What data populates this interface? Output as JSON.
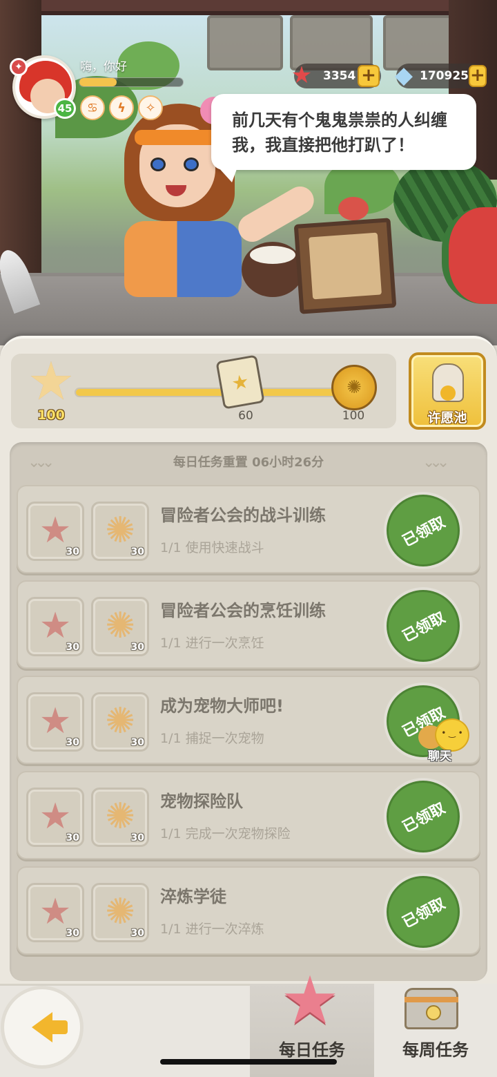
{
  "header": {
    "greeting": "嗨，你好",
    "level": "45",
    "xp_fraction": 0.36,
    "status_icons": [
      "crab-icon",
      "bolt-badge-icon",
      "compass-icon"
    ]
  },
  "currencies": [
    {
      "icon": "starfish-icon",
      "value": "3354",
      "plus": "+"
    },
    {
      "icon": "shell-gem-icon",
      "value": "170925",
      "plus": "+"
    }
  ],
  "npc": {
    "speech": "前几天有个鬼鬼祟祟的人纠缠我，我直接把他打趴了！"
  },
  "progress": {
    "fill_fraction": 1.0,
    "milestones": [
      {
        "icon": "star-trophy-icon",
        "label": "100"
      },
      {
        "icon": "card-reward-icon",
        "label": "60"
      },
      {
        "icon": "gold-coin-icon",
        "label": "100"
      }
    ]
  },
  "wish_pool": {
    "label": "许愿池"
  },
  "reset_text": "每日任务重置 06小时26分",
  "tasks": [
    {
      "title": "冒险者公会的战斗训练",
      "desc": "1/1 使用快速战斗",
      "reward1_qty": "30",
      "reward2_qty": "30",
      "status": "已领取"
    },
    {
      "title": "冒险者公会的烹饪训练",
      "desc": "1/1 进行一次烹饪",
      "reward1_qty": "30",
      "reward2_qty": "30",
      "status": "已领取"
    },
    {
      "title": "成为宠物大师吧!",
      "desc": "1/1 捕捉一次宠物",
      "reward1_qty": "30",
      "reward2_qty": "30",
      "status": "已领取"
    },
    {
      "title": "宠物探险队",
      "desc": "1/1 完成一次宠物探险",
      "reward1_qty": "30",
      "reward2_qty": "30",
      "status": "已领取"
    },
    {
      "title": "淬炼学徒",
      "desc": "1/1 进行一次淬炼",
      "reward1_qty": "30",
      "reward2_qty": "30",
      "status": "已领取"
    }
  ],
  "chat": {
    "label": "聊天"
  },
  "nav": {
    "daily_label": "每日任务",
    "weekly_label": "每周任务"
  },
  "colors": {
    "claimed_green": "#5f9e43",
    "accent_gold": "#f2c84a",
    "panel_bg": "#ebe7de"
  }
}
